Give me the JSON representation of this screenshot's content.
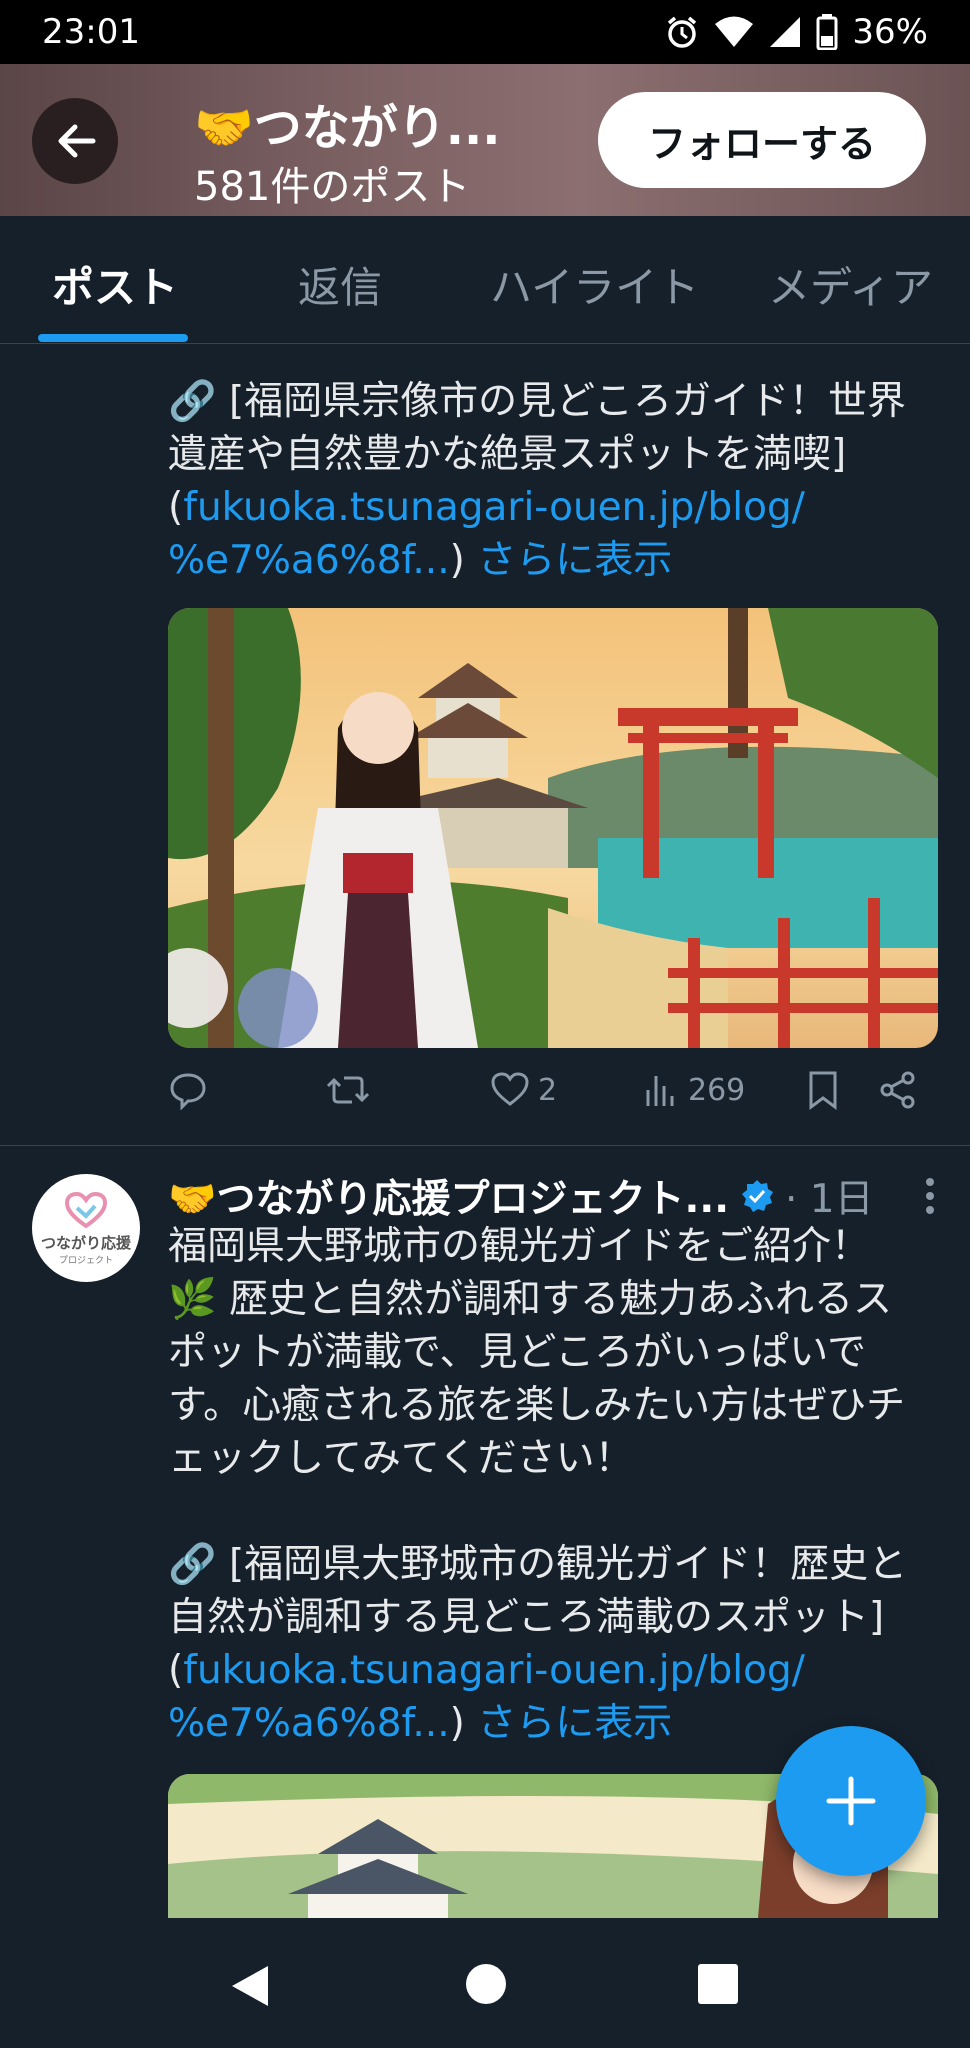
{
  "status_bar": {
    "time": "23:01",
    "battery": "36%"
  },
  "header": {
    "title": "🤝つながり...",
    "subtitle": "581件のポスト",
    "follow_label": "フォローする"
  },
  "tabs": [
    "ポスト",
    "返信",
    "ハイライト",
    "メディア"
  ],
  "tweet1": {
    "text_line1": "🔗 [福岡県宗像市の見どころガイド！世界",
    "text_line2": "遺産や自然豊かな絶景スポットを満喫]",
    "link_prefix": "(",
    "link_line1": "fukuoka.tsunagari-ouen.jp/blog/",
    "link_line2": "%e7%a6%8f...",
    "link_suffix": ") ",
    "show_more": "さらに表示",
    "likes": "2",
    "views": "269"
  },
  "tweet2": {
    "author": "🤝つながり応援プロジェクト...",
    "time": "· 1日",
    "avatar_text": "つながり応援",
    "avatar_sub": "プロジェクト",
    "line1": "福岡県大野城市の観光ガイドをご紹介！",
    "line2": "🌿 歴史と自然が調和する魅力あふれるス",
    "line3": "ポットが満載で、見どころがいっぱいで",
    "line4": "す。心癒される旅を楽しみたい方はぜひチ",
    "line5": "ェックしてみてください！",
    "line6": "🔗 [福岡県大野城市の観光ガイド！歴史と",
    "line7": "自然が調和する見どころ満載のスポット]",
    "link_prefix": "(",
    "link_line1": "fukuoka.tsunagari-ouen.jp/blog/",
    "link_line2": "%e7%a6%8f...",
    "link_suffix": ") ",
    "show_more": "さらに表示"
  },
  "colors": {
    "background": "#15202b",
    "accent": "#1d9bf0",
    "muted": "#8b98a5"
  }
}
